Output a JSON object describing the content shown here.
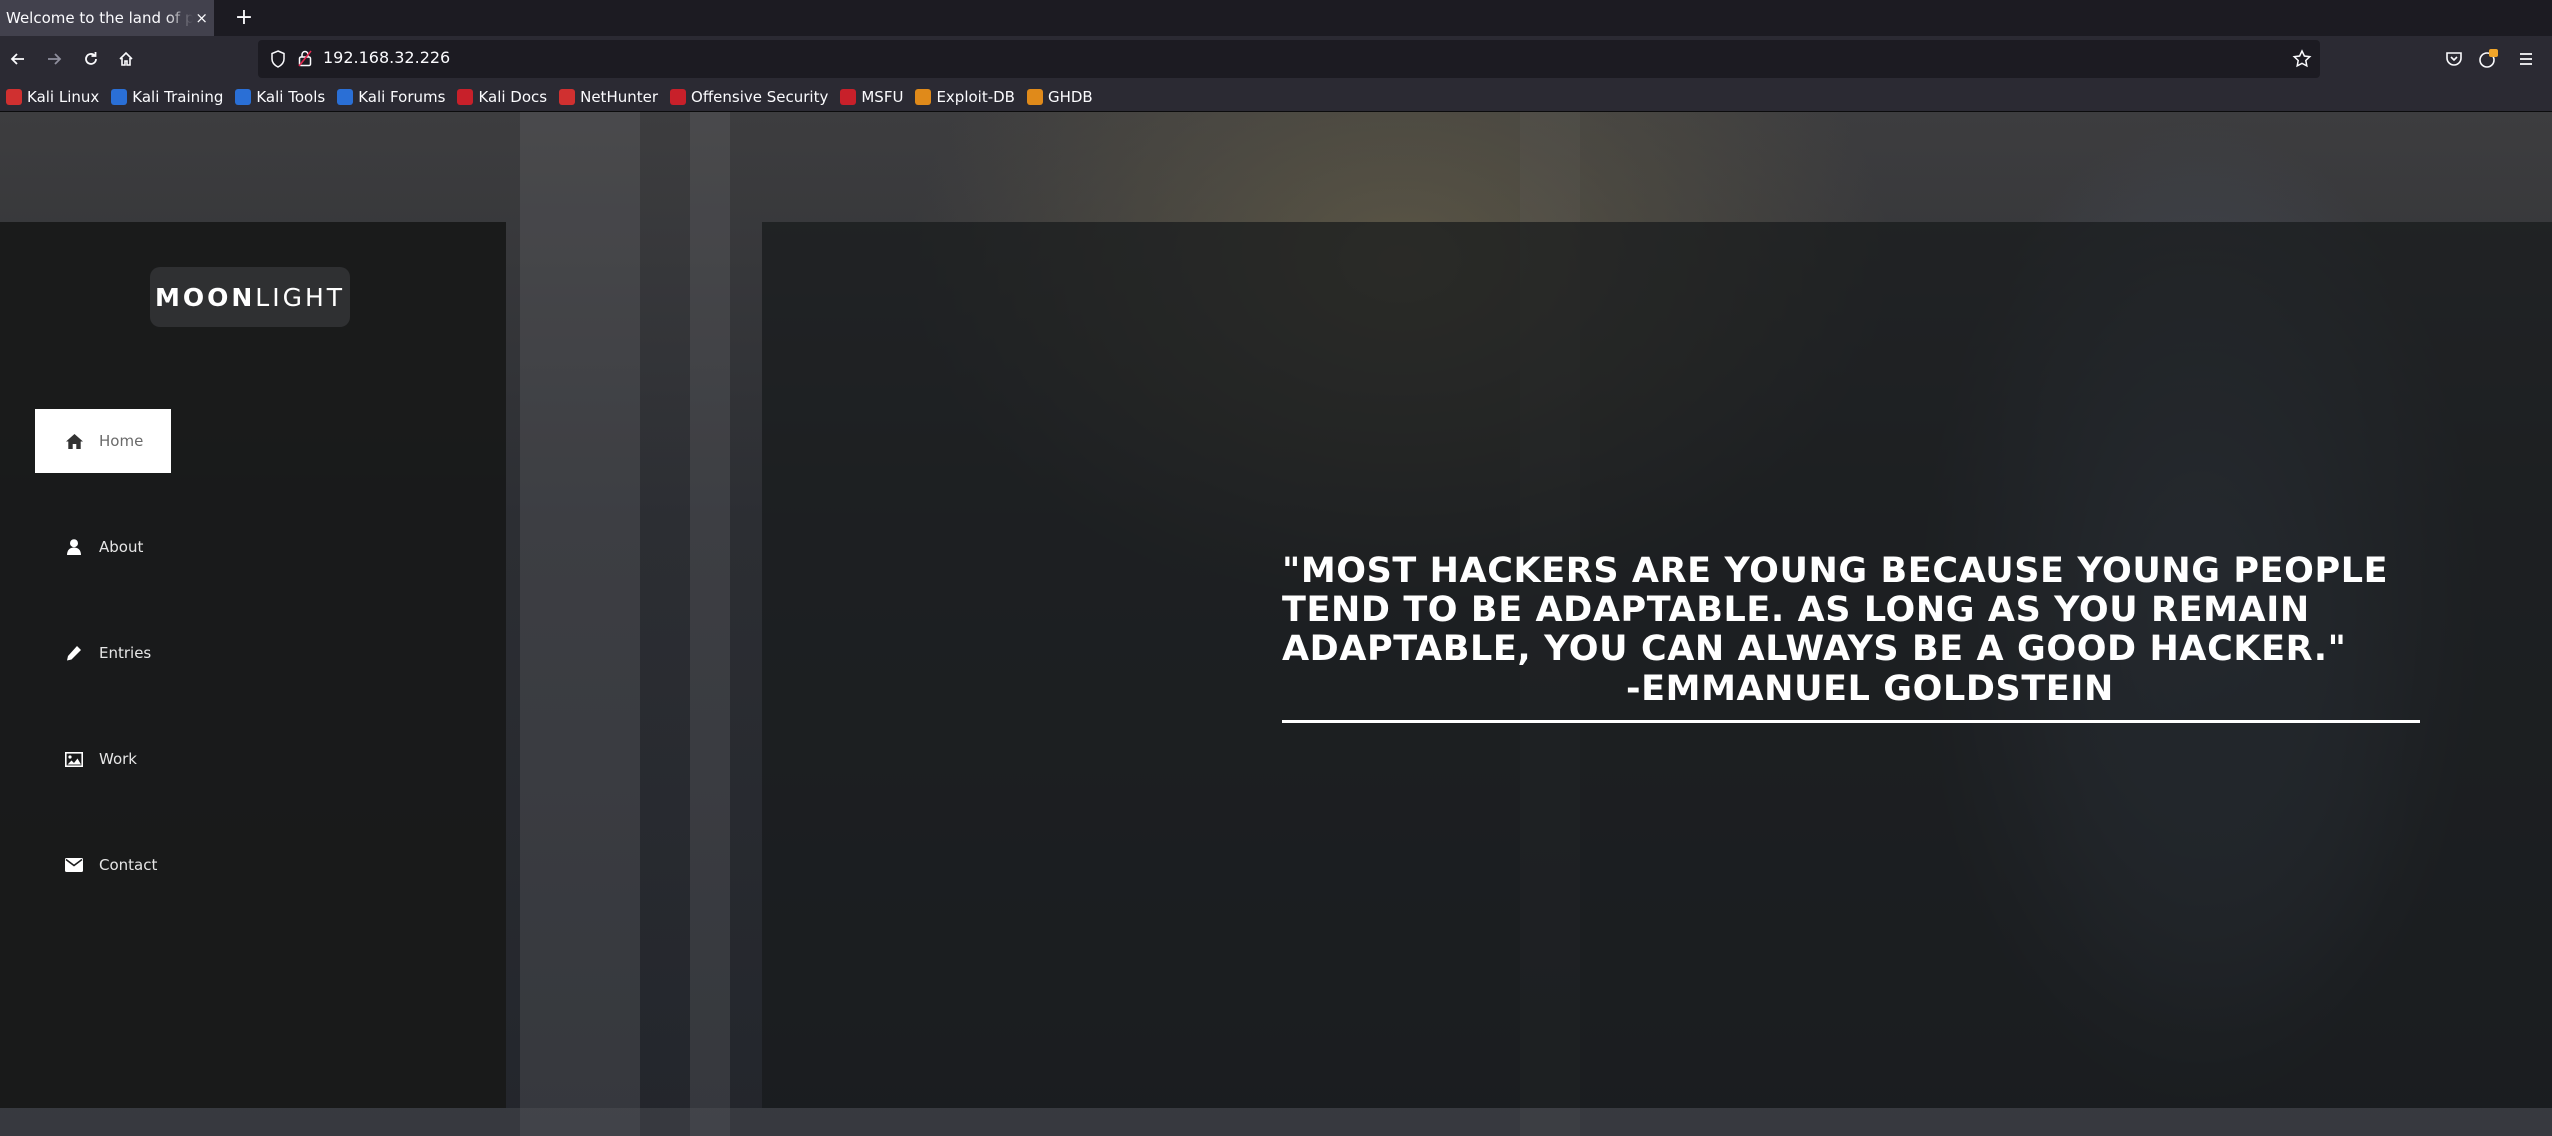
{
  "browser": {
    "tab_title": "Welcome to the land of pwnland",
    "tab_close": "×",
    "new_tab": "+",
    "url": "192.168.32.226",
    "bookmarks": [
      {
        "label": "Kali Linux",
        "icon": "kali-icon",
        "color": "#d03030"
      },
      {
        "label": "Kali Training",
        "icon": "kali-training-icon",
        "color": "#2a6fd6"
      },
      {
        "label": "Kali Tools",
        "icon": "kali-tools-icon",
        "color": "#2a6fd6"
      },
      {
        "label": "Kali Forums",
        "icon": "kali-forums-icon",
        "color": "#2a6fd6"
      },
      {
        "label": "Kali Docs",
        "icon": "kali-docs-icon",
        "color": "#c8202a"
      },
      {
        "label": "NetHunter",
        "icon": "nethunter-icon",
        "color": "#d03030"
      },
      {
        "label": "Offensive Security",
        "icon": "offsec-icon",
        "color": "#c8202a"
      },
      {
        "label": "MSFU",
        "icon": "msfu-icon",
        "color": "#c8202a"
      },
      {
        "label": "Exploit-DB",
        "icon": "exploitdb-icon",
        "color": "#e08a1a"
      },
      {
        "label": "GHDB",
        "icon": "ghdb-icon",
        "color": "#e08a1a"
      }
    ]
  },
  "site": {
    "logo_bold": "MOON",
    "logo_light": "LIGHT",
    "menu": [
      {
        "label": "Home",
        "icon": "home-icon",
        "active": true
      },
      {
        "label": "About",
        "icon": "user-icon",
        "active": false
      },
      {
        "label": "Entries",
        "icon": "pencil-icon",
        "active": false
      },
      {
        "label": "Work",
        "icon": "image-icon",
        "active": false
      },
      {
        "label": "Contact",
        "icon": "envelope-icon",
        "active": false
      }
    ],
    "quote": "\"MOST HACKERS ARE YOUNG BECAUSE YOUNG PEOPLE TEND TO BE ADAPTABLE. AS LONG AS YOU REMAIN ADAPTABLE, YOU CAN ALWAYS BE A GOOD HACKER.\"",
    "author": "-EMMANUEL GOLDSTEIN"
  }
}
